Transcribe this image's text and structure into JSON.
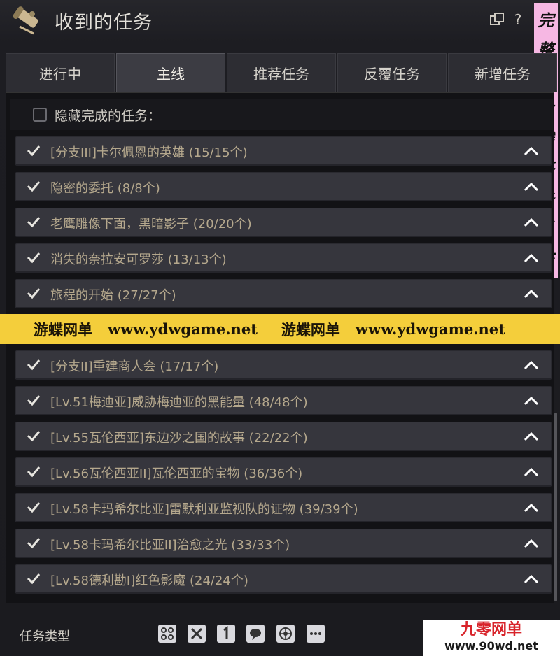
{
  "window": {
    "title": "收到的任务"
  },
  "titlebar_icons": [
    "popout-icon",
    "help-icon",
    "close-icon"
  ],
  "side_banner": [
    "完",
    "整",
    "的",
    "主",
    "线",
    "任",
    "务",
    "系",
    "统"
  ],
  "tabs": [
    {
      "label": "进行中",
      "active": false
    },
    {
      "label": "主线",
      "active": true
    },
    {
      "label": "推荐任务",
      "active": false
    },
    {
      "label": "反覆任务",
      "active": false
    },
    {
      "label": "新增任务",
      "active": false
    }
  ],
  "filter": {
    "label": "隐藏完成的任务：",
    "checked": false
  },
  "quests": [
    {
      "title": "[分支III]卡尔佩恩的英雄 (15/15个)"
    },
    {
      "title": "隐密的委托 (8/8个)"
    },
    {
      "title": "老鹰雕像下面，黑暗影子 (20/20个)"
    },
    {
      "title": "消失的奈拉安可罗莎 (13/13个)"
    },
    {
      "title": "旅程的开始 (27/27个)"
    },
    {
      "title": ""
    },
    {
      "title": "[分支II]重建商人会 (17/17个)"
    },
    {
      "title": "[Lv.51梅迪亚]威胁梅迪亚的黑能量 (48/48个)"
    },
    {
      "title": "[Lv.55瓦伦西亚]东边沙之国的故事 (22/22个)"
    },
    {
      "title": "[Lv.56瓦伦西亚II]瓦伦西亚的宝物 (36/36个)"
    },
    {
      "title": "[Lv.58卡玛希尔比亚]雷默利亚监视队的证物 (39/39个)"
    },
    {
      "title": "[Lv.58卡玛希尔比亚II]治愈之光 (33/33个)"
    },
    {
      "title": "[Lv.58德利勘I]红色影魔 (24/24个)"
    }
  ],
  "watermark": {
    "items": [
      "游蝶网单",
      "www.ydwgame.net",
      "游蝶网单",
      "www.ydwgame.net"
    ]
  },
  "footer": {
    "label": "任务类型",
    "icons": [
      "all-types-icon",
      "combat-type-icon",
      "single-type-icon",
      "chat-type-icon",
      "trade-type-icon",
      "more-icon"
    ]
  },
  "corner_badge": {
    "line1": "九零网单",
    "line2": "www.90wd.net"
  },
  "colors": {
    "quest_text": "#b5a88d",
    "watermark_bg": "#f4ce3b",
    "banner_bg": "#f6b7e3"
  }
}
